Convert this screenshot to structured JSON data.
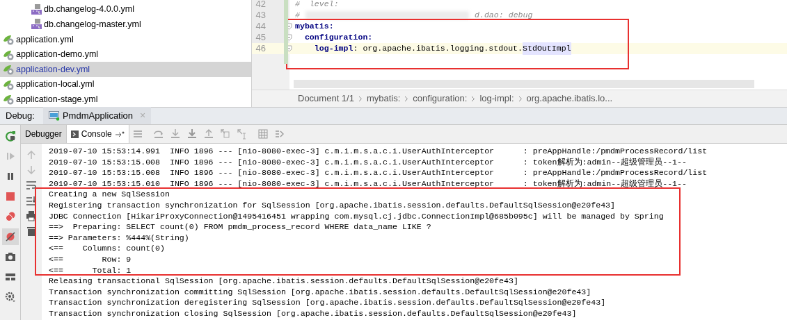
{
  "project_tree": {
    "nested_files": [
      {
        "name": "db.changelog-4.0.0.yml",
        "kind": "yml",
        "selected": false
      },
      {
        "name": "db.changelog-master.yml",
        "kind": "yml",
        "selected": false
      }
    ],
    "files": [
      {
        "name": "application.yml",
        "kind": "spring",
        "selected": false
      },
      {
        "name": "application-demo.yml",
        "kind": "spring",
        "selected": false
      },
      {
        "name": "application-dev.yml",
        "kind": "spring",
        "selected": true
      },
      {
        "name": "application-local.yml",
        "kind": "spring",
        "selected": false
      },
      {
        "name": "application-stage.yml",
        "kind": "spring",
        "selected": false
      }
    ]
  },
  "editor": {
    "highlight_frame": true,
    "lines": [
      {
        "number": "42",
        "current": false,
        "fold": false,
        "tokens": [
          {
            "kind": "comment",
            "text": "#  level:"
          }
        ]
      },
      {
        "number": "43",
        "current": false,
        "fold": false,
        "tokens": [
          {
            "kind": "comment",
            "text": "#"
          },
          {
            "kind": "redacted"
          },
          {
            "kind": "comment",
            "text": "d.dao: debug"
          }
        ]
      },
      {
        "number": "44",
        "current": false,
        "fold": true,
        "tokens": [
          {
            "kind": "key",
            "text": "mybatis:"
          }
        ]
      },
      {
        "number": "45",
        "current": false,
        "fold": true,
        "tokens": [
          {
            "kind": "key",
            "text": "  configuration:"
          }
        ]
      },
      {
        "number": "46",
        "current": true,
        "fold": true,
        "tokens": [
          {
            "kind": "key",
            "text": "    log-impl"
          },
          {
            "kind": "plain",
            "text": ": org.apache.ibatis.logging.stdout."
          },
          {
            "kind": "match",
            "text": "StdOutImpl"
          }
        ]
      }
    ],
    "breadcrumbs": [
      "Document 1/1",
      "mybatis:",
      "configuration:",
      "log-impl:",
      "org.apache.ibatis.lo..."
    ]
  },
  "debug_panel": {
    "label": "Debug:",
    "session_tab": {
      "title": "PmdmApplication",
      "close": "×"
    },
    "tabs": [
      {
        "label": "Debugger",
        "selected": false
      },
      {
        "label": "Console",
        "selected": true
      }
    ]
  },
  "console": {
    "highlight_frame": true,
    "lines": [
      "2019-07-10 15:53:14.991  INFO 1896 --- [nio-8080-exec-3] c.m.i.m.s.a.c.i.UserAuthInterceptor      : preAppHandle:/pmdmProcessRecord/list",
      "2019-07-10 15:53:15.008  INFO 1896 --- [nio-8080-exec-3] c.m.i.m.s.a.c.i.UserAuthInterceptor      : token解析为:admin--超级管理员--1--",
      "2019-07-10 15:53:15.008  INFO 1896 --- [nio-8080-exec-3] c.m.i.m.s.a.c.i.UserAuthInterceptor      : preAppHandle:/pmdmProcessRecord/list",
      "2019-07-10 15:53:15.010  INFO 1896 --- [nio-8080-exec-3] c.m.i.m.s.a.c.i.UserAuthInterceptor      : token解析为:admin--超级管理员--1--",
      "Creating a new SqlSession",
      "Registering transaction synchronization for SqlSession [org.apache.ibatis.session.defaults.DefaultSqlSession@e20fe43]",
      "JDBC Connection [HikariProxyConnection@1495416451 wrapping com.mysql.cj.jdbc.ConnectionImpl@685b095c] will be managed by Spring",
      "==>  Preparing: SELECT count(0) FROM pmdm_process_record WHERE data_name LIKE ?",
      "==> Parameters: %444%(String)",
      "<==    Columns: count(0)",
      "<==        Row: 9",
      "<==      Total: 1",
      "Releasing transactional SqlSession [org.apache.ibatis.session.defaults.DefaultSqlSession@e20fe43]",
      "Transaction synchronization committing SqlSession [org.apache.ibatis.session.defaults.DefaultSqlSession@e20fe43]",
      "Transaction synchronization deregistering SqlSession [org.apache.ibatis.session.defaults.DefaultSqlSession@e20fe43]",
      "Transaction synchronization closing SqlSession [org.apache.ibatis.session.defaults.DefaultSqlSession@e20fe43]"
    ]
  }
}
